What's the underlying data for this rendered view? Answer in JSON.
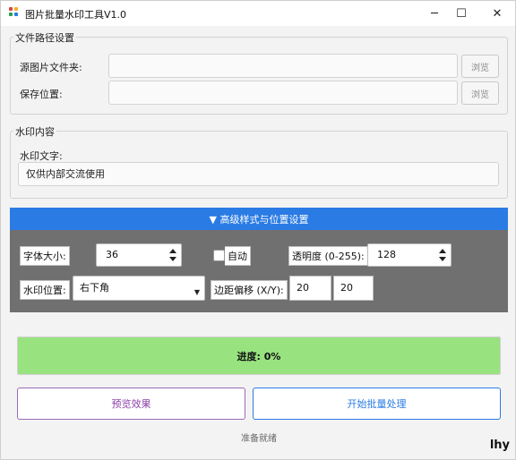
{
  "window": {
    "title": "图片批量水印工具V1.0",
    "controls": {
      "minimize": "─",
      "maximize": "☐",
      "close": "✕"
    }
  },
  "file_group": {
    "title": "文件路径设置",
    "source_label": "源图片文件夹:",
    "source_value": "",
    "save_label": "保存位置:",
    "save_value": "",
    "browse_label": "浏览"
  },
  "watermark_group": {
    "title": "水印内容",
    "text_label": "水印文字:",
    "text_value": "仅供内部交流使用"
  },
  "advanced": {
    "header": "▼ 高级样式与位置设置",
    "font_size_label": "字体大小:",
    "font_size_value": "36",
    "auto_label": "自动",
    "auto_checked": false,
    "opacity_label": "透明度 (0-255):",
    "opacity_value": "128",
    "position_label": "水印位置:",
    "position_value": "右下角",
    "margin_label": "边距偏移 (X/Y):",
    "margin_x": "20",
    "margin_y": "20"
  },
  "progress": {
    "text": "进度: 0%",
    "value": 0
  },
  "buttons": {
    "preview": "预览效果",
    "start": "开始批量处理"
  },
  "status": "准备就绪",
  "signature": "lhy",
  "colors": {
    "accent": "#2b7be4",
    "panel": "#707070",
    "progress_fill": "#98e380",
    "preview_text": "#8a3fa8",
    "start_text": "#2b7be4"
  }
}
